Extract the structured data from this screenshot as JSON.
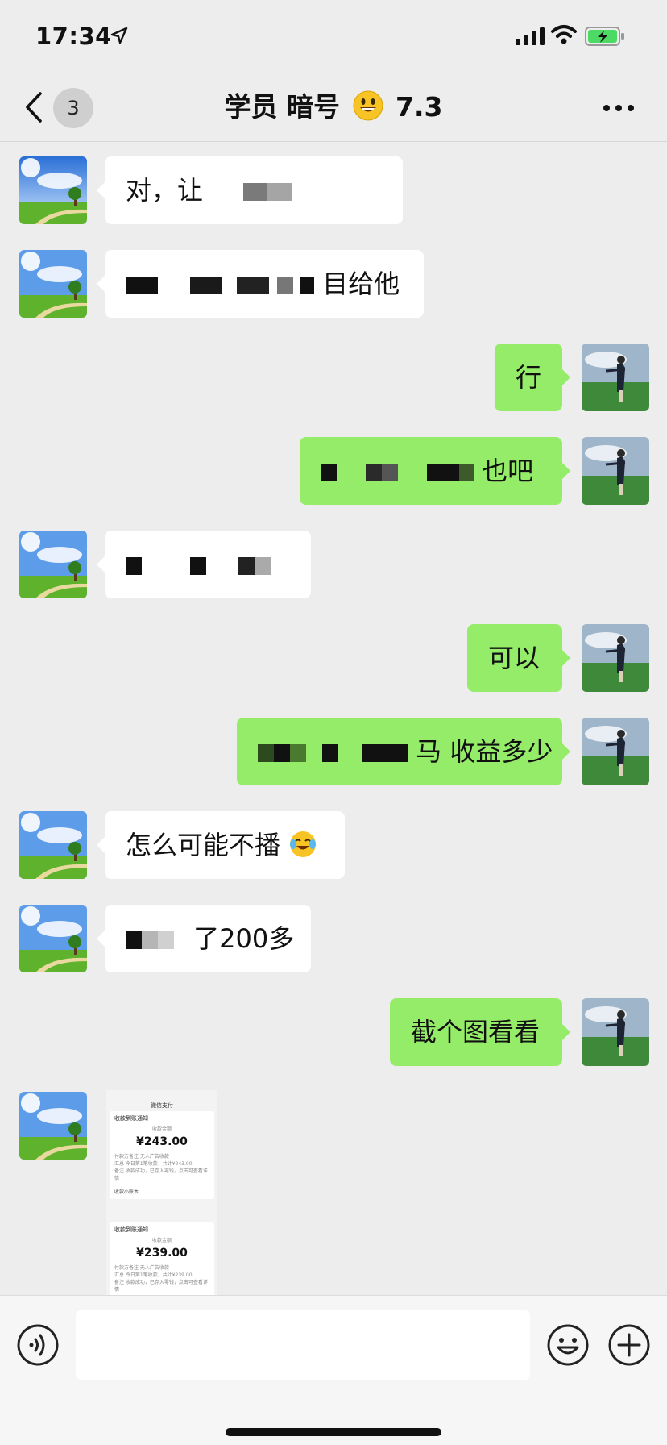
{
  "status": {
    "time": "17:34"
  },
  "header": {
    "back_badge": "3",
    "title_prefix": "学员 暗号",
    "title_suffix": "7.3"
  },
  "messages": [
    {
      "side": "in",
      "text": "对，让"
    },
    {
      "side": "in",
      "text": "目给他"
    },
    {
      "side": "out",
      "text": "行"
    },
    {
      "side": "out",
      "text": "也吧"
    },
    {
      "side": "in",
      "text": ""
    },
    {
      "side": "out",
      "text": "可以"
    },
    {
      "side": "out",
      "text": "马 收益多少"
    },
    {
      "side": "in",
      "text": "怎么可能不播"
    },
    {
      "side": "in",
      "text": "了200多"
    },
    {
      "side": "out",
      "text": "截个图看看"
    }
  ],
  "image_message": {
    "header": "微信支付",
    "card1": {
      "title": "收款到账通知",
      "label": "收款金额",
      "amount": "¥243.00",
      "note": "付款方备注 无人广告收款",
      "total": "汇总 今日第1笔收款，共计¥243.00",
      "remark": "备注 收款成功，已存入零钱，点击可查看详情",
      "link": "收款小账本"
    },
    "card2": {
      "title": "收款到账通知",
      "label": "收款金额",
      "amount": "¥239.00",
      "note": "付款方备注 无人广告收款",
      "total": "汇总 今日第1笔收款，共计¥239.00",
      "remark": "备注 收款成功，已存入零钱，点击可查看详情"
    }
  },
  "colors": {
    "outgoing_bubble": "#95ec69",
    "incoming_bubble": "#ffffff",
    "background": "#ededed"
  }
}
